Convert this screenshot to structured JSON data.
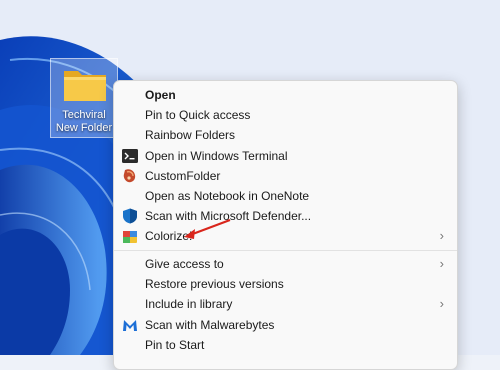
{
  "desktop": {
    "folder": {
      "name_line1": "Techviral",
      "name_line2": "New Folder",
      "icon": "folder-icon"
    }
  },
  "context_menu": {
    "items": [
      {
        "label": "Open",
        "bold": true,
        "icon": null,
        "submenu": false
      },
      {
        "label": "Pin to Quick access",
        "icon": null,
        "submenu": false
      },
      {
        "label": "Rainbow Folders",
        "icon": null,
        "submenu": false
      },
      {
        "label": "Open in Windows Terminal",
        "icon": "terminal-icon",
        "submenu": false
      },
      {
        "label": "CustomFolder",
        "icon": "customfolder-icon",
        "submenu": false
      },
      {
        "label": "Open as Notebook in OneNote",
        "icon": null,
        "submenu": false
      },
      {
        "label": "Scan with Microsoft Defender...",
        "icon": "defender-shield-icon",
        "submenu": false
      },
      {
        "label": "Colorize!",
        "icon": "colorize-icon",
        "submenu": true
      },
      {
        "label": "Give access to",
        "icon": null,
        "submenu": true
      },
      {
        "label": "Restore previous versions",
        "icon": null,
        "submenu": false
      },
      {
        "label": "Include in library",
        "icon": null,
        "submenu": true
      },
      {
        "label": "Scan with Malwarebytes",
        "icon": "malwarebytes-icon",
        "submenu": false
      },
      {
        "label": "Pin to Start",
        "icon": null,
        "submenu": false
      }
    ],
    "submenu_glyph": "›"
  },
  "annotation": {
    "type": "arrow",
    "color": "#d9261c",
    "points_to": "Colorize!"
  },
  "colors": {
    "wallpaper_blue": "#1b5fd6",
    "wallpaper_light": "#dfe7f6",
    "menu_background": "#f9f9f9",
    "annotation_red": "#d9261c"
  }
}
